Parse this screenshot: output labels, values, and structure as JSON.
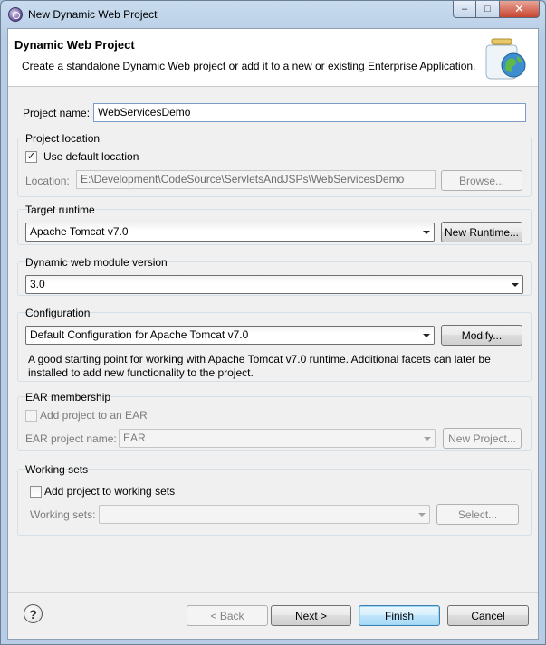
{
  "window": {
    "title": "New Dynamic Web Project",
    "icon": "eclipse-icon"
  },
  "banner": {
    "title": "Dynamic Web Project",
    "description": "Create a standalone Dynamic Web project or add it to a new or existing Enterprise Application.",
    "icon": "web-project-jar-globe-icon"
  },
  "project_name": {
    "label": "Project name:",
    "value": "WebServicesDemo"
  },
  "project_location": {
    "group_label": "Project location",
    "use_default_label": "Use default location",
    "use_default_checked": true,
    "location_label": "Location:",
    "location_value": "E:\\Development\\CodeSource\\ServletsAndJSPs\\WebServicesDemo",
    "browse_label": "Browse..."
  },
  "target_runtime": {
    "group_label": "Target runtime",
    "selected": "Apache Tomcat v7.0",
    "new_runtime_label": "New Runtime..."
  },
  "module_version": {
    "group_label": "Dynamic web module version",
    "selected": "3.0"
  },
  "configuration": {
    "group_label": "Configuration",
    "selected": "Default Configuration for Apache Tomcat v7.0",
    "modify_label": "Modify...",
    "description_line1": "A good starting point for working with Apache Tomcat v7.0 runtime. Additional facets can later be",
    "description_line2": "installed to add new functionality to the project."
  },
  "ear": {
    "group_label": "EAR membership",
    "add_label": "Add project to an EAR",
    "add_checked": false,
    "project_name_label": "EAR project name:",
    "project_name_value": "EAR",
    "new_project_label": "New Project..."
  },
  "working_sets": {
    "group_label": "Working sets",
    "add_label": "Add project to working sets",
    "add_checked": false,
    "sets_label": "Working sets:",
    "sets_value": "",
    "select_label": "Select..."
  },
  "footer": {
    "help_icon": "help-icon",
    "back_label": "< Back",
    "next_label": "Next >",
    "finish_label": "Finish",
    "cancel_label": "Cancel"
  }
}
